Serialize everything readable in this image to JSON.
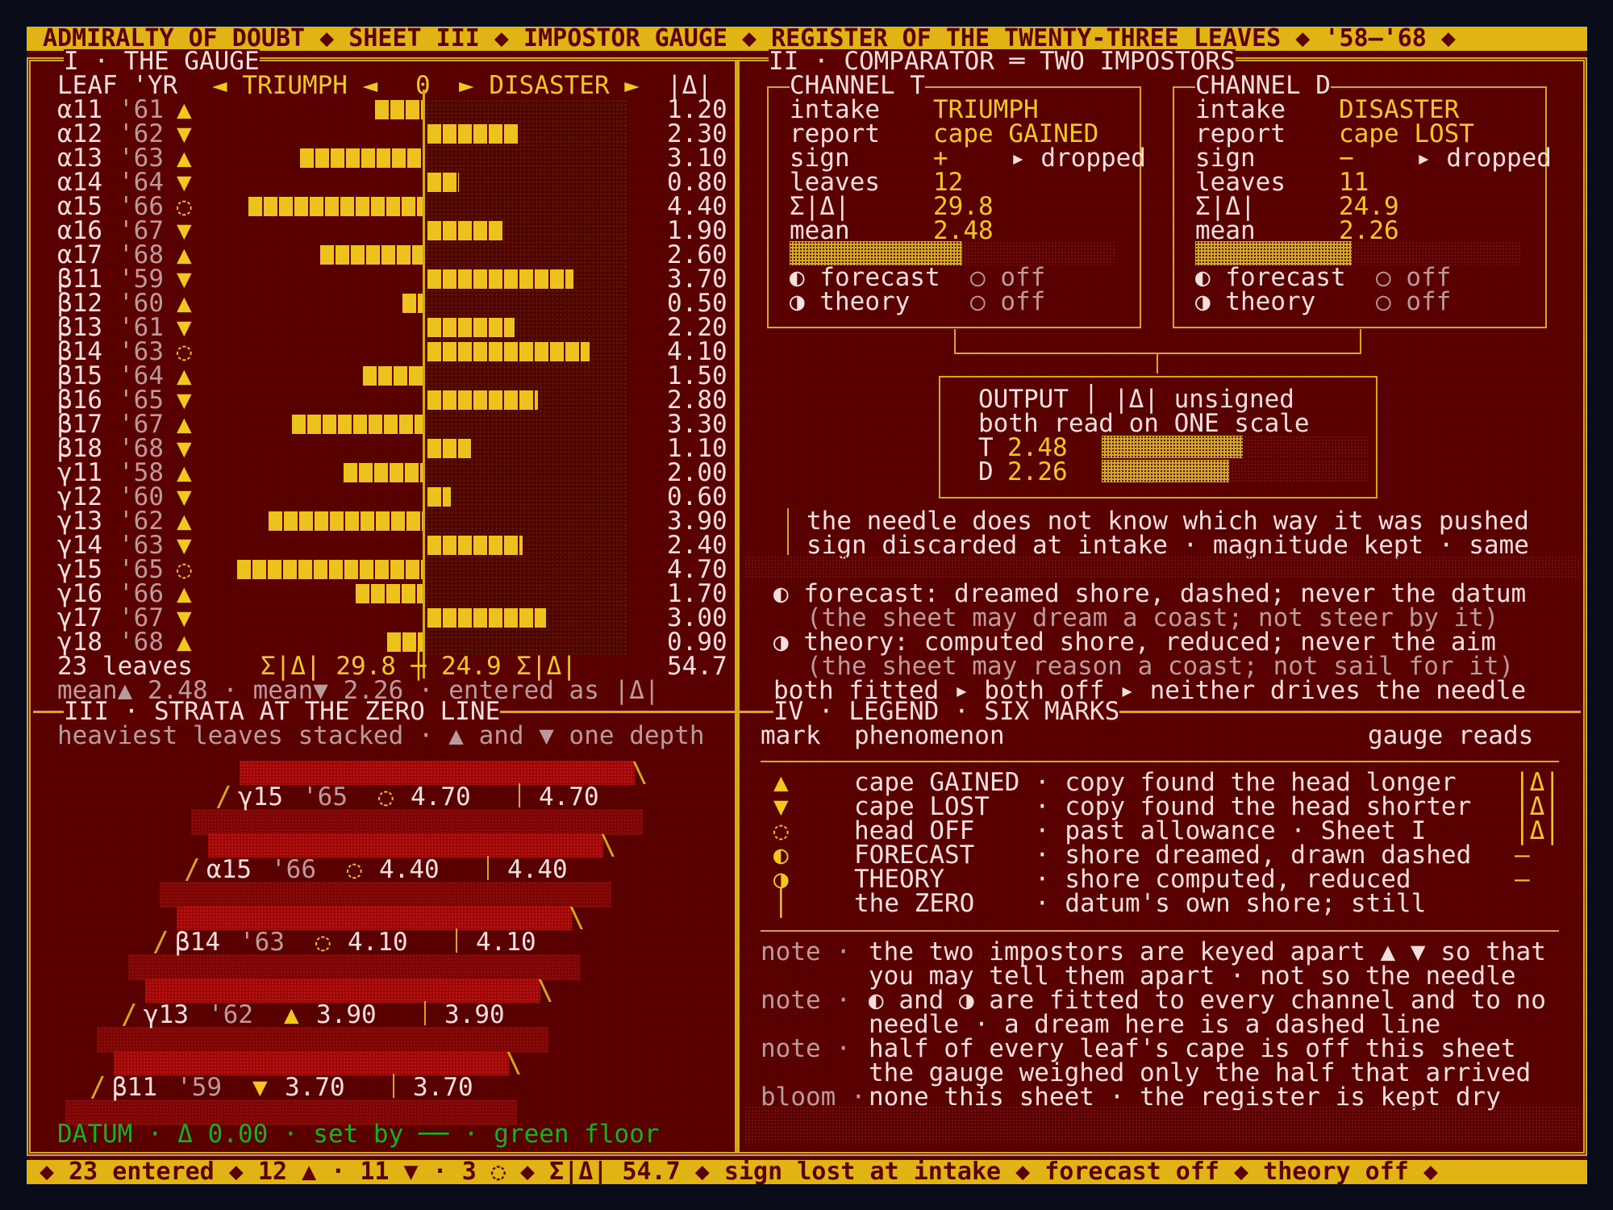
{
  "header": {
    "title": "ADMIRALTY OF DOUBT ◆ SHEET III ◆ IMPOSTOR GAUGE ◆ REGISTER OF THE TWENTY-THREE LEAVES ◆ '58–'68 ◆"
  },
  "gauge": {
    "title": "I · THE GAUGE",
    "col_leaf": "LEAF 'YR",
    "col_triumph": "◄ TRIUMPH ◄",
    "col_zero": "0",
    "col_disaster": "► DISASTER ►",
    "col_mag": "|Δ|",
    "rows": [
      {
        "leaf": "α11",
        "yr": "'61",
        "mark": "▲",
        "side": "T",
        "mag": "1.20"
      },
      {
        "leaf": "α12",
        "yr": "'62",
        "mark": "▼",
        "side": "D",
        "mag": "2.30"
      },
      {
        "leaf": "α13",
        "yr": "'63",
        "mark": "▲",
        "side": "T",
        "mag": "3.10"
      },
      {
        "leaf": "α14",
        "yr": "'64",
        "mark": "▼",
        "side": "D",
        "mag": "0.80"
      },
      {
        "leaf": "α15",
        "yr": "'66",
        "mark": "◌",
        "side": "T",
        "mag": "4.40"
      },
      {
        "leaf": "α16",
        "yr": "'67",
        "mark": "▼",
        "side": "D",
        "mag": "1.90"
      },
      {
        "leaf": "α17",
        "yr": "'68",
        "mark": "▲",
        "side": "T",
        "mag": "2.60"
      },
      {
        "leaf": "β11",
        "yr": "'59",
        "mark": "▼",
        "side": "D",
        "mag": "3.70"
      },
      {
        "leaf": "β12",
        "yr": "'60",
        "mark": "▲",
        "side": "T",
        "mag": "0.50"
      },
      {
        "leaf": "β13",
        "yr": "'61",
        "mark": "▼",
        "side": "D",
        "mag": "2.20"
      },
      {
        "leaf": "β14",
        "yr": "'63",
        "mark": "◌",
        "side": "D",
        "mag": "4.10"
      },
      {
        "leaf": "β15",
        "yr": "'64",
        "mark": "▲",
        "side": "T",
        "mag": "1.50"
      },
      {
        "leaf": "β16",
        "yr": "'65",
        "mark": "▼",
        "side": "D",
        "mag": "2.80"
      },
      {
        "leaf": "β17",
        "yr": "'67",
        "mark": "▲",
        "side": "T",
        "mag": "3.30"
      },
      {
        "leaf": "β18",
        "yr": "'68",
        "mark": "▼",
        "side": "D",
        "mag": "1.10"
      },
      {
        "leaf": "γ11",
        "yr": "'58",
        "mark": "▲",
        "side": "T",
        "mag": "2.00"
      },
      {
        "leaf": "γ12",
        "yr": "'60",
        "mark": "▼",
        "side": "D",
        "mag": "0.60"
      },
      {
        "leaf": "γ13",
        "yr": "'62",
        "mark": "▲",
        "side": "T",
        "mag": "3.90"
      },
      {
        "leaf": "γ14",
        "yr": "'63",
        "mark": "▼",
        "side": "D",
        "mag": "2.40"
      },
      {
        "leaf": "γ15",
        "yr": "'65",
        "mark": "◌",
        "side": "T",
        "mag": "4.70"
      },
      {
        "leaf": "γ16",
        "yr": "'66",
        "mark": "▲",
        "side": "T",
        "mag": "1.70"
      },
      {
        "leaf": "γ17",
        "yr": "'67",
        "mark": "▼",
        "side": "D",
        "mag": "3.00"
      },
      {
        "leaf": "γ18",
        "yr": "'68",
        "mark": "▲",
        "side": "T",
        "mag": "0.90"
      }
    ],
    "total_leaves": "23 leaves",
    "total_sums": "Σ|Δ| 29.8 ┼ 24.9 Σ|Δ|",
    "total_mag": "54.7",
    "means": "mean▲ 2.48 · mean▼ 2.26 · entered as |Δ|"
  },
  "comparator": {
    "title": "II · COMPARATOR ═ TWO IMPOSTORS",
    "channels": [
      {
        "title": "CHANNEL T",
        "intake": "TRIUMPH",
        "report": "cape GAINED",
        "sign": "+",
        "dropped": "▸ dropped",
        "leaves": "12",
        "sum": "29.8",
        "mean": "2.48",
        "fill": 0.53,
        "forecast": "◐ forecast",
        "forecast_state": "○ off",
        "theory": "◑ theory",
        "theory_state": "○ off"
      },
      {
        "title": "CHANNEL D",
        "intake": "DISASTER",
        "report": "cape LOST",
        "sign": "−",
        "dropped": "▸ dropped",
        "leaves": "11",
        "sum": "24.9",
        "mean": "2.26",
        "fill": 0.48,
        "forecast": "◐ forecast",
        "forecast_state": "○ off",
        "theory": "◑ theory",
        "theory_state": "○ off"
      }
    ],
    "labels": {
      "intake": "intake",
      "report": "report",
      "sign": "sign",
      "leaves": "leaves",
      "sum": "Σ|Δ|",
      "mean": "mean"
    },
    "output": {
      "line1": "OUTPUT │ |Δ| unsigned",
      "line2": "both read on ONE scale",
      "t_label": "T",
      "t_value": "2.48",
      "t_fill": 0.53,
      "d_label": "D",
      "d_value": "2.26",
      "d_fill": 0.48
    },
    "needle_line1": "the needle does not know which way it was pushed",
    "needle_line2": "sign discarded at intake · magnitude kept · same",
    "forecast_line": "◐ forecast: dreamed shore, dashed; never the datum",
    "forecast_sub": "(the sheet may dream a coast; not steer by it)",
    "theory_line": "◑ theory: computed shore, reduced; never the aim",
    "theory_sub": "(the sheet may reason a coast; not sail for it)",
    "fitted_line": "both fitted ▸ both off ▸ neither drives the needle"
  },
  "strata": {
    "title": "III · STRATA AT THE ZERO LINE",
    "subtitle": "heaviest leaves stacked · ▲ and ▼ one depth",
    "layers": [
      {
        "leaf": "γ15",
        "yr": "'65",
        "mark": "◌",
        "value": "4.70",
        "mag": "4.70"
      },
      {
        "leaf": "α15",
        "yr": "'66",
        "mark": "◌",
        "value": "4.40",
        "mag": "4.40"
      },
      {
        "leaf": "β14",
        "yr": "'63",
        "mark": "◌",
        "value": "4.10",
        "mag": "4.10"
      },
      {
        "leaf": "γ13",
        "yr": "'62",
        "mark": "▲",
        "value": "3.90",
        "mag": "3.90"
      },
      {
        "leaf": "β11",
        "yr": "'59",
        "mark": "▼",
        "value": "3.70",
        "mag": "3.70"
      }
    ],
    "datum": "DATUM · Δ 0.00 · set by ── · green floor"
  },
  "legend": {
    "title": "IV · LEGEND · SIX MARKS",
    "col_mark": "mark",
    "col_phen": "phenomenon",
    "col_reads": "gauge reads",
    "rows": [
      {
        "mark": "▲",
        "name": "cape GAINED",
        "desc": "· copy found the head longer",
        "reads": "|Δ|"
      },
      {
        "mark": "▼",
        "name": "cape LOST",
        "desc": "· copy found the head shorter",
        "reads": "|Δ|"
      },
      {
        "mark": "◌",
        "name": "head OFF",
        "desc": "· past allowance · Sheet I",
        "reads": "|Δ|"
      },
      {
        "mark": "◐",
        "name": "FORECAST",
        "desc": "· shore dreamed, drawn dashed",
        "reads": "—"
      },
      {
        "mark": "◑",
        "name": "THEORY",
        "desc": "· shore computed, reduced",
        "reads": "—"
      },
      {
        "mark": "│",
        "name": "the ZERO",
        "desc": "· datum's own shore; still",
        "reads": ""
      }
    ],
    "notes": [
      {
        "k": "note ·",
        "a": "the two impostors are keyed apart ▲ ▼ so that",
        "b": "you may tell them apart · not so the needle"
      },
      {
        "k": "note ·",
        "a": "◐ and ◑ are fitted to every channel and to no",
        "b": "needle · a dream here is a dashed line"
      },
      {
        "k": "note ·",
        "a": "half of every leaf's cape is off this sheet",
        "b": "the gauge weighed only the half that arrived"
      },
      {
        "k": "bloom ·",
        "a": "none this sheet · the register is kept dry",
        "b": ""
      }
    ]
  },
  "footer": {
    "text": "◆ 23 entered ◆ 12 ▲ · 11 ▼ · 3 ◌ ◆ Σ|Δ| 54.7 ◆ sign lost at intake ◆ forecast off ◆ theory off ◆"
  },
  "colors": {
    "background": "#5c0000",
    "amber": "#f2c81e",
    "text": "#f4dede",
    "dim": "#bd9a9a",
    "green": "#19b01e"
  }
}
